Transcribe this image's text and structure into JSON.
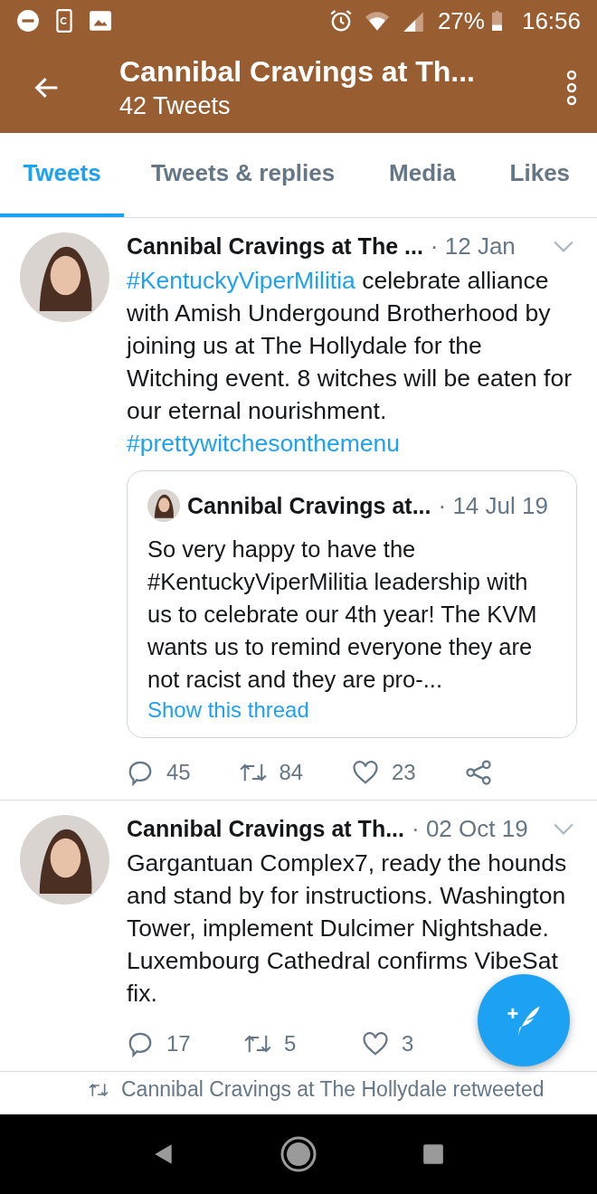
{
  "status_bar": {
    "battery": "27%",
    "time": "16:56"
  },
  "header": {
    "title": "Cannibal Cravings at Th...",
    "subtitle": "42 Tweets"
  },
  "tabs": [
    {
      "label": "Tweets",
      "selected": true
    },
    {
      "label": "Tweets & replies",
      "selected": false
    },
    {
      "label": "Media",
      "selected": false
    },
    {
      "label": "Likes",
      "selected": false
    }
  ],
  "tweets": [
    {
      "name": "Cannibal Cravings at The ...",
      "date": "· 12 Jan",
      "body": [
        {
          "kind": "hashtag",
          "text": "#KentuckyViperMilitia"
        },
        {
          "kind": "text",
          "text": " celebrate alliance with Amish Undergound Brotherhood by joining us at The Hollydale for the Witching event. 8 witches will be eaten for our eternal nourishment. "
        },
        {
          "kind": "hashtag",
          "text": "#prettywitchesonthemenu"
        }
      ],
      "quote": {
        "name": "Cannibal Cravings at...",
        "date": "· 14 Jul 19",
        "text": "So very happy to have the #KentuckyViperMilitia leadership with us to celebrate our 4th year! The KVM wants us to remind everyone they are not racist and they are pro-...",
        "link": "Show this thread"
      },
      "replies": "45",
      "retweets": "84",
      "likes": "23",
      "share": true
    },
    {
      "name": "Cannibal Cravings at Th...",
      "date": "· 02 Oct 19",
      "body": [
        {
          "kind": "text",
          "text": "Gargantuan Complex7, ready the hounds and stand by for instructions. Washington Tower, implement Dulcimer Nightshade. Luxembourg Cathedral confirms VibeSat fix."
        }
      ],
      "replies": "17",
      "retweets": "5",
      "likes": "3",
      "share": false
    }
  ],
  "retweet_notice": "Cannibal Cravings at The Hollydale retweeted"
}
